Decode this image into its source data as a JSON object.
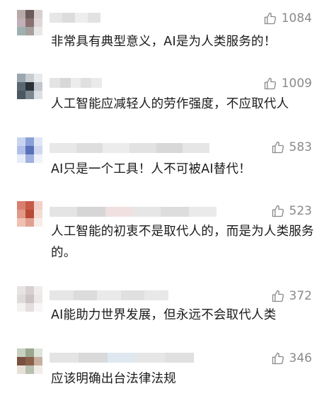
{
  "comments": [
    {
      "likes": "1084",
      "text": "非常具有典型意义，AI是为人类服务的！",
      "avatar": [
        "#b8a8a8",
        "#6a5a5a",
        "#d8cfcf",
        "#c0b0b8",
        "#8a7070",
        "#e0d8d8",
        "#9fb0b0",
        "#a8a0a0",
        "#e8e8e8"
      ],
      "name_blocks": [
        "#e6e6e6",
        "#dcdcdc",
        "#eeeeee",
        "#e2e2e2"
      ]
    },
    {
      "likes": "1009",
      "text": "人工智能应减轻人的劳作强度，不应取代人",
      "avatar": [
        "#9aa6b0",
        "#c8ccd0",
        "#e8eaec",
        "#5a6670",
        "#2a3238",
        "#c0c6cc",
        "#4a5660",
        "#7a8690",
        "#dde0e2"
      ],
      "name_blocks": [
        "#e4e4e4",
        "#d8d8d8",
        "#ececec",
        "#e0e0e0",
        "#eaeaea"
      ]
    },
    {
      "likes": "583",
      "text": "AI只是一个工具！人不可被AI替代！",
      "avatar": [
        "#c8d4f0",
        "#8aa0d8",
        "#e0e6f6",
        "#b0bfe8",
        "#5a70b8",
        "#d0d8f0",
        "#e8ecf8",
        "#a0b0e0",
        "#f0f2fa"
      ],
      "name_blocks": [
        "#e8e8e8",
        "#dedede",
        "#ececec",
        "#e2e2e2",
        "#d8d8d8",
        "#e6e6e6"
      ]
    },
    {
      "likes": "523",
      "text": "人工智能的初衷不是取代人的，而是为人类服务的。",
      "avatar": [
        "#d88070",
        "#c85a48",
        "#f0d0c8",
        "#e09888",
        "#b84a38",
        "#f4dcd4",
        "#f0c0b0",
        "#e0a090",
        "#f8ece8"
      ],
      "name_blocks": [
        "#e4e4e4",
        "#d6d6d6",
        "#f0e0e0",
        "#e6e6e6",
        "#dddddd",
        "#eaeaea"
      ]
    },
    {
      "likes": "372",
      "text": "AI能助力世界发展，但永远不会取代人类",
      "avatar": [
        "#e8e4e4",
        "#d8d0d0",
        "#f0ecec",
        "#e0dada",
        "#ccc4c4",
        "#ece8e8",
        "#f4f2f2",
        "#e4dede",
        "#f8f6f6"
      ],
      "name_blocks": [
        "#e6e6e6",
        "#dcdcdc",
        "#eaeaea",
        "#e0e0e0",
        "#e8e8e8"
      ]
    },
    {
      "likes": "346",
      "text": "应该明确出台法律法规",
      "avatar": [
        "#c8d0c0",
        "#9aa890",
        "#e0e4dc",
        "#7a5040",
        "#8a6048",
        "#c8b0a0",
        "#e8e0d8",
        "#b8c0b0",
        "#f0ece8"
      ],
      "name_blocks": [
        "#e4e4e4",
        "#dadada",
        "#dfe8f0",
        "#e6e6e6",
        "#e0e0e0"
      ]
    }
  ]
}
